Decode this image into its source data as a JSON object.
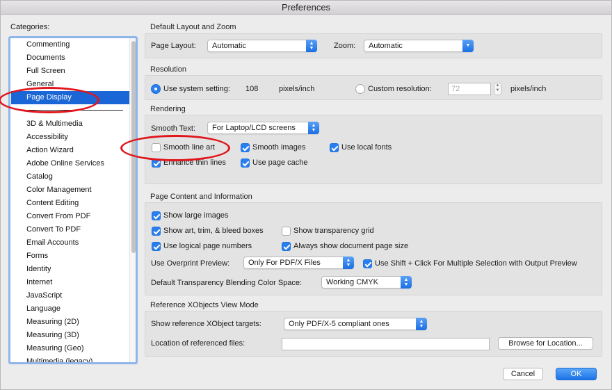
{
  "window": {
    "title": "Preferences"
  },
  "categories": {
    "label": "Categories:",
    "top_items": [
      "Commenting",
      "Documents",
      "Full Screen",
      "General",
      "Page Display"
    ],
    "selected": "Page Display",
    "items": [
      "3D & Multimedia",
      "Accessibility",
      "Action Wizard",
      "Adobe Online Services",
      "Catalog",
      "Color Management",
      "Content Editing",
      "Convert From PDF",
      "Convert To PDF",
      "Email Accounts",
      "Forms",
      "Identity",
      "Internet",
      "JavaScript",
      "Language",
      "Measuring (2D)",
      "Measuring (3D)",
      "Measuring (Geo)",
      "Multimedia (legacy)"
    ]
  },
  "layout_zoom": {
    "title": "Default Layout and Zoom",
    "page_layout_label": "Page Layout:",
    "page_layout_value": "Automatic",
    "zoom_label": "Zoom:",
    "zoom_value": "Automatic"
  },
  "resolution": {
    "title": "Resolution",
    "use_system_label": "Use system setting:",
    "use_system_selected": true,
    "system_value": "108",
    "system_unit": "pixels/inch",
    "custom_label": "Custom resolution:",
    "custom_selected": false,
    "custom_value": "72",
    "custom_unit": "pixels/inch"
  },
  "rendering": {
    "title": "Rendering",
    "smooth_text_label": "Smooth Text:",
    "smooth_text_value": "For Laptop/LCD screens",
    "options": {
      "smooth_line_art": {
        "label": "Smooth line art",
        "checked": false
      },
      "smooth_images": {
        "label": "Smooth images",
        "checked": true
      },
      "use_local_fonts": {
        "label": "Use local fonts",
        "checked": true
      },
      "enhance_thin_lines": {
        "label": "Enhance thin lines",
        "checked": true
      },
      "use_page_cache": {
        "label": "Use page cache",
        "checked": true
      }
    }
  },
  "page_content": {
    "title": "Page Content and Information",
    "options": {
      "show_large_images": {
        "label": "Show large images",
        "checked": true
      },
      "show_art_trim": {
        "label": "Show art, trim, & bleed boxes",
        "checked": true
      },
      "show_transparency_grid": {
        "label": "Show transparency grid",
        "checked": false
      },
      "logical_page_numbers": {
        "label": "Use logical page numbers",
        "checked": true
      },
      "always_show_size": {
        "label": "Always show document page size",
        "checked": true
      },
      "shift_click": {
        "label": "Use Shift + Click For Multiple Selection with Output Preview",
        "checked": true
      }
    },
    "overprint_label": "Use Overprint Preview:",
    "overprint_value": "Only For PDF/X Files",
    "blending_label": "Default Transparency Blending Color Space:",
    "blending_value": "Working CMYK"
  },
  "xobjects": {
    "title": "Reference XObjects View Mode",
    "targets_label": "Show reference XObject targets:",
    "targets_value": "Only PDF/X-5 compliant ones",
    "location_label": "Location of referenced files:",
    "location_value": "",
    "browse_label": "Browse for Location..."
  },
  "footer": {
    "cancel_label": "Cancel",
    "ok_label": "OK"
  },
  "colors": {
    "accent": "#1a66d6",
    "annotation": "#e0161c"
  }
}
